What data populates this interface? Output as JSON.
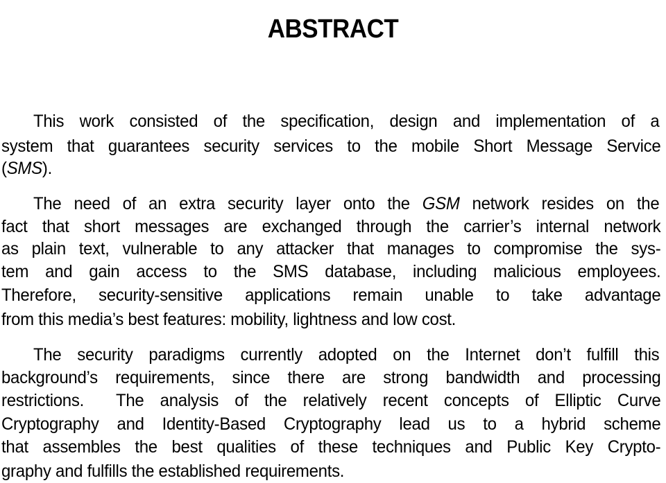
{
  "document": {
    "title": "ABSTRACT",
    "paragraphs": [
      {
        "lines": [
          {
            "text": "This work consisted of the specification, design and implementation of a"
          },
          {
            "text": "system that guarantees security services to the mobile Short Message Service"
          },
          {
            "pre": "(",
            "em": "SMS",
            "post": ")."
          }
        ]
      },
      {
        "lines": [
          {
            "pre": "The need of an extra security layer onto the ",
            "em": "GSM",
            "post": " network resides on the"
          },
          {
            "text": "fact that short messages are exchanged through the carrier’s internal network"
          },
          {
            "text": "as plain text, vulnerable to any attacker that manages to compromise the sys-"
          },
          {
            "text": "tem and gain access to the SMS database, including malicious employees."
          },
          {
            "text": "Therefore, security-sensitive applications remain unable to take advantage"
          },
          {
            "text": "from this media’s best features: mobility, lightness and low cost."
          }
        ]
      },
      {
        "lines": [
          {
            "text": "The security paradigms currently adopted on the Internet don’t fulfill this"
          },
          {
            "text": "background’s requirements, since there are strong bandwidth and processing"
          },
          {
            "text": "restrictions.  The analysis of the relatively recent concepts of Elliptic Curve"
          },
          {
            "text": "Cryptography and Identity-Based Cryptography lead us to a hybrid scheme"
          },
          {
            "text": "that assembles the best qualities of these techniques and Public Key Crypto-"
          },
          {
            "text": "graphy and fulfills the established requirements."
          }
        ]
      }
    ]
  }
}
